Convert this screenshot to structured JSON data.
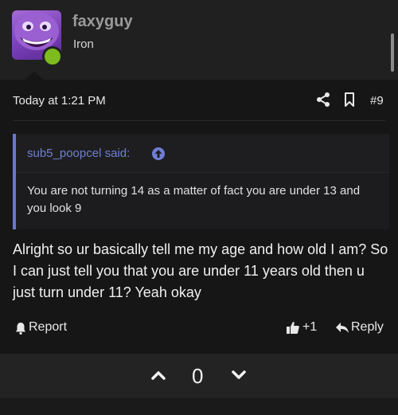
{
  "author": {
    "username": "faxyguy",
    "user_title": "Iron",
    "avatar_icon": "purple-smiling-creature-avatar",
    "online_status_color": "#7dbb1e"
  },
  "post": {
    "timestamp": "Today at 1:21 PM",
    "post_number": "#9",
    "share_icon": "share-icon",
    "bookmark_icon": "bookmark-icon"
  },
  "quote": {
    "author_label": "sub5_poopcel said:",
    "text": "You are not turning 14 as a matter of fact you are under 13 and you look 9",
    "accent_color": "#6a78c9"
  },
  "message": {
    "text": "Alright so ur basically tell me my age and how old I am? So I can just tell you that you are under 11 years old then u just turn under 11? Yeah okay"
  },
  "actions": {
    "report_label": "Report",
    "like_count": "+1",
    "reply_label": "Reply"
  },
  "votes": {
    "score": "0"
  }
}
